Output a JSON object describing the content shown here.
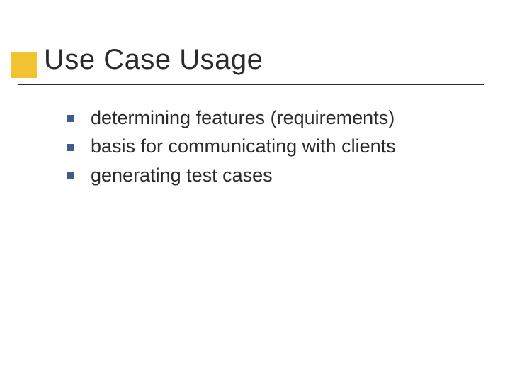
{
  "slide": {
    "title": "Use Case Usage",
    "bullets": [
      "determining features (requirements)",
      "basis for communicating with clients",
      "generating test cases"
    ]
  }
}
